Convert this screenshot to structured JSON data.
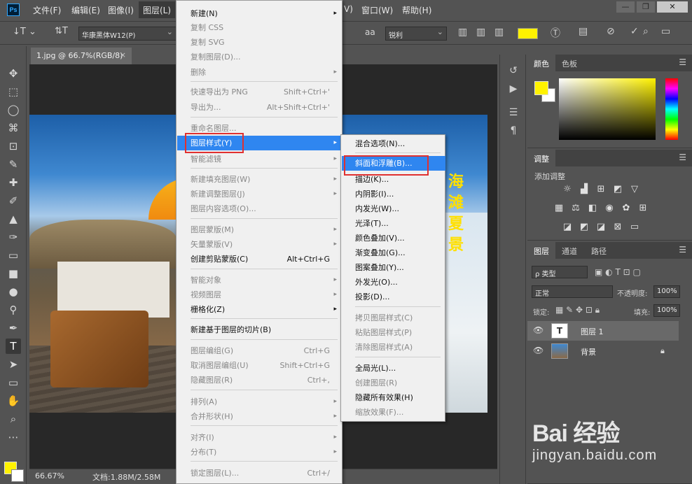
{
  "app": {
    "logo": "Ps"
  },
  "menubar": {
    "items": [
      "文件(F)",
      "编辑(E)",
      "图像(I)",
      "图层(L)",
      "V)",
      "窗口(W)",
      "帮助(H)"
    ],
    "window_controls": [
      "—",
      "❐",
      "✕"
    ]
  },
  "options": {
    "font_family": "华康黑体W12(P)",
    "anti_alias_icon": "aa",
    "anti_alias": "锐利",
    "text_color": "#fff200"
  },
  "document": {
    "tab_label": "1.jpg @ 66.7%(RGB/8)",
    "tab_close": "×",
    "photo_text": "海滩夏景",
    "zoom": "66.67%",
    "doc_size": "文档:1.88M/2.58M"
  },
  "colors": {
    "foreground": "#fff200",
    "background": "#ffffff",
    "menu_highlight": "#2f86f0"
  },
  "panels": {
    "color_tabs": [
      "颜色",
      "色板"
    ],
    "adjust_tab": "调整",
    "adjust_label": "添加调整",
    "layers_tabs": [
      "图层",
      "通道",
      "路径"
    ],
    "kind_filter": "ρ 类型",
    "blend_mode": "正常",
    "opacity_label": "不透明度:",
    "opacity_value": "100%",
    "lock_label": "锁定:",
    "fill_label": "填充:",
    "fill_value": "100%",
    "layers": [
      {
        "name": "图层 1",
        "thumb": "T"
      },
      {
        "name": "背景"
      }
    ]
  },
  "layer_menu": {
    "items": [
      {
        "label": "新建(N)",
        "arrow": "▸"
      },
      {
        "label": "复制 CSS"
      },
      {
        "label": "复制 SVG"
      },
      {
        "label": "复制图层(D)..."
      },
      {
        "label": "删除",
        "arrow": "▸"
      },
      {
        "label": "快速导出为 PNG",
        "shortcut": "Shift+Ctrl+'"
      },
      {
        "label": "导出为...",
        "shortcut": "Alt+Shift+Ctrl+'"
      },
      {
        "label": "重命名图层..."
      },
      {
        "label": "图层样式(Y)",
        "arrow": "▸"
      },
      {
        "label": "智能滤镜",
        "arrow": "▸"
      },
      {
        "label": "新建填充图层(W)",
        "arrow": "▸"
      },
      {
        "label": "新建调整图层(J)",
        "arrow": "▸"
      },
      {
        "label": "图层内容选项(O)..."
      },
      {
        "label": "图层蒙版(M)",
        "arrow": "▸"
      },
      {
        "label": "矢量蒙版(V)",
        "arrow": "▸"
      },
      {
        "label": "创建剪贴蒙版(C)",
        "shortcut": "Alt+Ctrl+G"
      },
      {
        "label": "智能对象",
        "arrow": "▸"
      },
      {
        "label": "视频图层",
        "arrow": "▸"
      },
      {
        "label": "栅格化(Z)",
        "arrow": "▸"
      },
      {
        "label": "新建基于图层的切片(B)"
      },
      {
        "label": "图层编组(G)",
        "shortcut": "Ctrl+G"
      },
      {
        "label": "取消图层编组(U)",
        "shortcut": "Shift+Ctrl+G"
      },
      {
        "label": "隐藏图层(R)",
        "shortcut": "Ctrl+,"
      },
      {
        "label": "排列(A)",
        "arrow": "▸"
      },
      {
        "label": "合并形状(H)",
        "arrow": "▸"
      },
      {
        "label": "对齐(I)",
        "arrow": "▸"
      },
      {
        "label": "分布(T)",
        "arrow": "▸"
      },
      {
        "label": "锁定图层(L)...",
        "shortcut": "Ctrl+/"
      }
    ]
  },
  "style_submenu": {
    "items": [
      {
        "label": "混合选项(N)..."
      },
      {
        "label": "斜面和浮雕(B)..."
      },
      {
        "label": "描边(K)..."
      },
      {
        "label": "内阴影(I)..."
      },
      {
        "label": "内发光(W)..."
      },
      {
        "label": "光泽(T)..."
      },
      {
        "label": "颜色叠加(V)..."
      },
      {
        "label": "渐变叠加(G)..."
      },
      {
        "label": "图案叠加(Y)..."
      },
      {
        "label": "外发光(O)..."
      },
      {
        "label": "投影(D)..."
      },
      {
        "label": "拷贝图层样式(C)"
      },
      {
        "label": "粘贴图层样式(P)"
      },
      {
        "label": "清除图层样式(A)"
      },
      {
        "label": "全局光(L)..."
      },
      {
        "label": "创建图层(R)"
      },
      {
        "label": "隐藏所有效果(H)"
      },
      {
        "label": "缩放效果(F)..."
      }
    ]
  },
  "watermark": {
    "brand": "Bai 经验",
    "url": "jingyan.baidu.com"
  }
}
